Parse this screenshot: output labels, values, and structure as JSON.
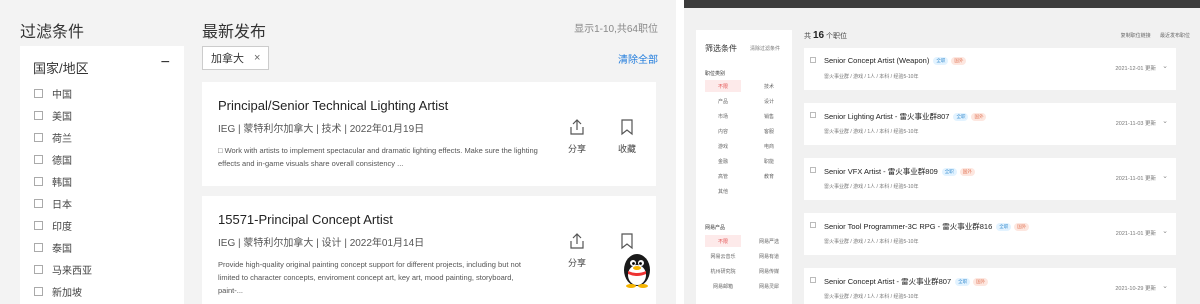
{
  "left": {
    "filter_title": "过滤条件",
    "filter_group": "国家/地区",
    "collapse_symbol": "−",
    "countries": [
      "中国",
      "美国",
      "荷兰",
      "德国",
      "韩国",
      "日本",
      "印度",
      "泰国",
      "马来西亚",
      "新加坡"
    ],
    "latest_title": "最新发布",
    "result_count": "显示1-10,共64职位",
    "chip_label": "加拿大",
    "chip_close": "×",
    "clear_all": "清除全部",
    "share_label": "分享",
    "fav_label": "收藏",
    "jobs": [
      {
        "title": "Principal/Senior Technical Lighting Artist",
        "meta": "IEG | 蒙特利尔加拿大 | 技术 | 2022年01月19日",
        "desc": "□ Work with artists to implement spectacular and dramatic lighting effects. Make sure the lighting effects and in-game visuals share overall consistency ..."
      },
      {
        "title": "15571-Principal Concept Artist",
        "meta": "IEG | 蒙特利尔加拿大 | 设计 | 2022年01月14日",
        "desc": "Provide high-quality original painting concept support for different projects, including but not limited to character concepts, enviroment concept art, key art, mood painting, storyboard, paint-..."
      }
    ]
  },
  "right": {
    "side_title": "筛选条件",
    "side_clear": "清除过滤条件",
    "section_category": "职位类别",
    "categories": [
      "不限",
      "技术",
      "产品",
      "设计",
      "市场",
      "销售",
      "内容",
      "客服",
      "游戏",
      "电商",
      "金融",
      "职能",
      "高管",
      "教育",
      "其他"
    ],
    "section_product": "网易产品",
    "products": [
      "不限",
      "网易严选",
      "网易云音乐",
      "网易有道",
      "杭州研究院",
      "网易传媒",
      "网易邮箱",
      "网易灵犀"
    ],
    "total_prefix": "共",
    "total_count": "16",
    "total_suffix": "个职位",
    "total_right_1": "复制职位链接",
    "total_right_2": "最近发布职位",
    "tag_a": "全职",
    "tag_b": "国外",
    "jobs": [
      {
        "title": "Senior Concept Artist (Weapon)",
        "meta": "雷火事业群  /  游戏  /  1人  /  本科  /  经验5-10年",
        "date": "2021-12-01 更新"
      },
      {
        "title": "Senior Lighting Artist - 雷火事业群807",
        "meta": "雷火事业群  /  游戏  /  1人  /  本科  /  经验5-10年",
        "date": "2021-11-03 更新"
      },
      {
        "title": "Senior VFX Artist - 雷火事业群809",
        "meta": "雷火事业群  /  游戏  /  1人  /  本科  /  经验5-10年",
        "date": "2021-11-01 更新"
      },
      {
        "title": "Senior Tool Programmer-3C RPG - 雷火事业群816",
        "meta": "雷火事业群  /  游戏  /  2人  /  本科  /  经验5-10年",
        "date": "2021-11-01 更新"
      },
      {
        "title": "Senior Concept Artist - 雷火事业群807",
        "meta": "雷火事业群  /  游戏  /  1人  /  本科  /  经验5-10年",
        "date": "2021-10-29 更新"
      }
    ]
  }
}
